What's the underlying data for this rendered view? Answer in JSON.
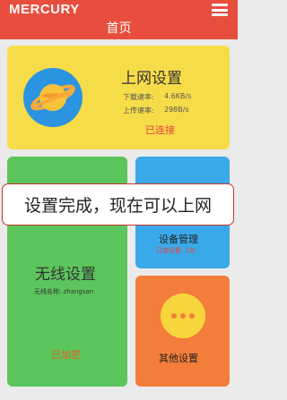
{
  "header": {
    "brand": "MERCURY",
    "title": "首页"
  },
  "internet_card": {
    "title": "上网设置",
    "download_label": "下载速率:",
    "download_value": "4.6KB/s",
    "upload_label": "上传速率:",
    "upload_value": "298B/s",
    "status": "已连接"
  },
  "wireless_card": {
    "title": "无线设置",
    "ssid_label": "无线名称:",
    "ssid_value": "zhangsan",
    "status": "已加密"
  },
  "device_card": {
    "title": "设备管理",
    "connected_text": "已连设备: 1台"
  },
  "other_card": {
    "title": "其他设置"
  },
  "toast": {
    "message": "设置完成，现在可以上网"
  },
  "icons": {
    "menu": "hamburger-menu-icon",
    "internet": "planet-icon",
    "other": "more-dots-icon"
  },
  "colors": {
    "header": "#e84e3d",
    "internet_card": "#f7dc49",
    "wireless_card": "#5cc55c",
    "device_card": "#3aa9e9",
    "other_card": "#f37d3a",
    "status_red": "#e8413b",
    "toast_border": "#c8352b"
  }
}
